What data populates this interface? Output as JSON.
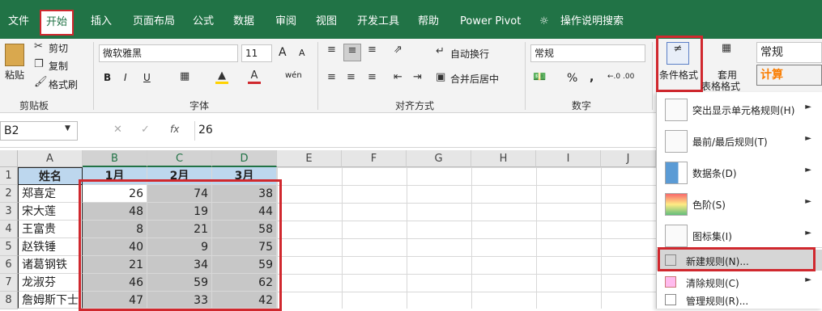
{
  "tabs": [
    {
      "label": "文件"
    },
    {
      "label": "开始"
    },
    {
      "label": "插入"
    },
    {
      "label": "页面布局"
    },
    {
      "label": "公式"
    },
    {
      "label": "数据"
    },
    {
      "label": "审阅"
    },
    {
      "label": "视图"
    },
    {
      "label": "开发工具"
    },
    {
      "label": "帮助"
    },
    {
      "label": "Power Pivot"
    },
    {
      "label": "操作说明搜索"
    }
  ],
  "clipboard": {
    "paste": "粘贴",
    "cut": "剪切",
    "copy": "复制",
    "format_painter": "格式刷",
    "group": "剪贴板"
  },
  "font": {
    "name": "微软雅黑",
    "size": "11",
    "group": "字体",
    "wen": "wén",
    "bold": "B",
    "italic": "I",
    "underline": "U",
    "grow": "A",
    "shrink": "A"
  },
  "alignment": {
    "wrap": "自动换行",
    "merge": "合并后居中",
    "group": "对齐方式"
  },
  "number": {
    "format": "常规",
    "group": "数字",
    "percent": "%",
    "comma": ",",
    "dec_inc": "←.0 .00",
    "dec_dec": ".00 →.0"
  },
  "styles": {
    "cond_format": "条件格式",
    "table_format_1": "套用",
    "table_format_2": "表格格式",
    "style_normal": "常规",
    "style_calc": "计算"
  },
  "formula_bar": {
    "cell_ref": "B2",
    "value": "26",
    "fx": "fx"
  },
  "columns": [
    "A",
    "B",
    "C",
    "D",
    "E",
    "F",
    "G",
    "H",
    "I",
    "J"
  ],
  "rows": [
    "1",
    "2",
    "3",
    "4",
    "5",
    "6",
    "7",
    "8"
  ],
  "headers": [
    "姓名",
    "1月",
    "2月",
    "3月"
  ],
  "table": [
    {
      "name": "郑喜定",
      "b": "26",
      "c": "74",
      "d": "38"
    },
    {
      "name": "宋大莲",
      "b": "48",
      "c": "19",
      "d": "44"
    },
    {
      "name": "王富贵",
      "b": "8",
      "c": "21",
      "d": "58"
    },
    {
      "name": "赵铁锤",
      "b": "40",
      "c": "9",
      "d": "75"
    },
    {
      "name": "诸葛钢铁",
      "b": "21",
      "c": "34",
      "d": "59"
    },
    {
      "name": "龙淑芬",
      "b": "46",
      "c": "59",
      "d": "62"
    },
    {
      "name": "詹姆斯下士",
      "b": "47",
      "c": "33",
      "d": "42"
    }
  ],
  "menu": {
    "items": [
      {
        "label": "突出显示单元格规则(H)",
        "submenu": true
      },
      {
        "label": "最前/最后规则(T)",
        "submenu": true
      },
      {
        "label": "数据条(D)",
        "submenu": true
      },
      {
        "label": "色阶(S)",
        "submenu": true
      },
      {
        "label": "图标集(I)",
        "submenu": true
      },
      {
        "label": "新建规则(N)...",
        "submenu": false
      },
      {
        "label": "清除规则(C)",
        "submenu": true
      },
      {
        "label": "管理规则(R)...",
        "submenu": false
      }
    ]
  },
  "colors": {
    "accent": "#217346",
    "highlight_red": "#d0282e",
    "header_fill": "#bdd7ee",
    "selected_fill": "#c7c7c7"
  }
}
